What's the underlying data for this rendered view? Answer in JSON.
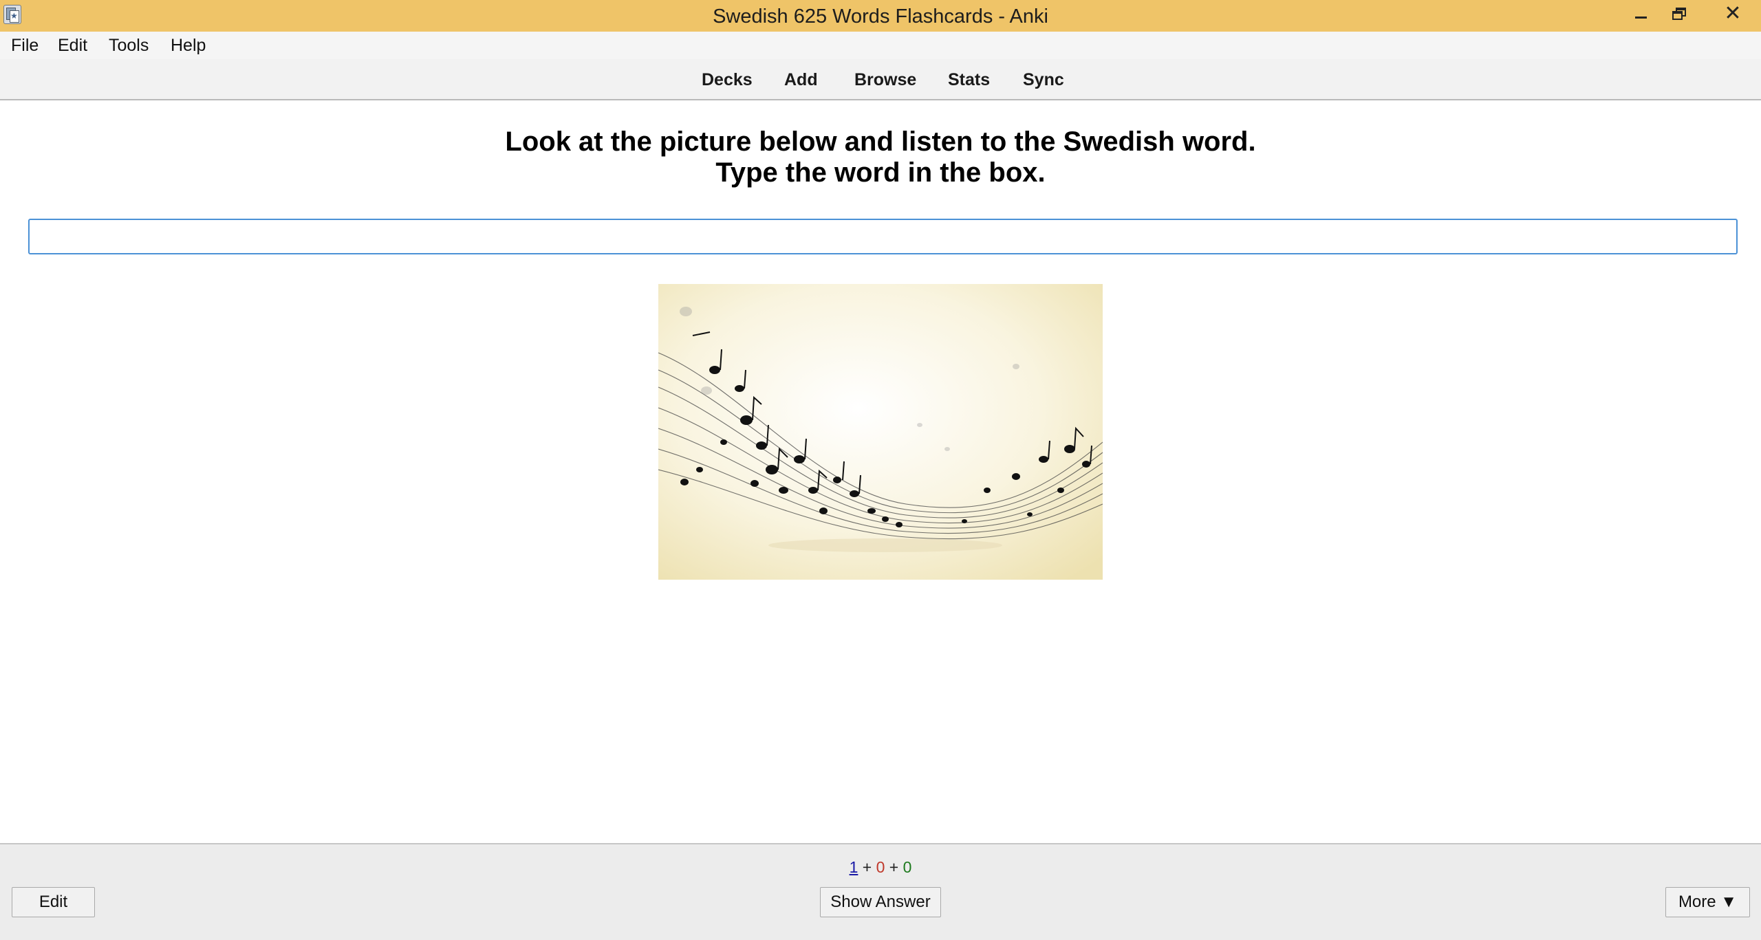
{
  "window": {
    "title": "Swedish 625 Words Flashcards - Anki",
    "close_glyph": "✕"
  },
  "menu": {
    "items": [
      "File",
      "Edit",
      "Tools",
      "Help"
    ]
  },
  "toolbar": {
    "links": [
      "Decks",
      "Add",
      "Browse",
      "Stats",
      "Sync"
    ]
  },
  "card": {
    "prompt_line1": "Look at the picture below and listen to the Swedish word.",
    "prompt_line2": "Type the word in the box.",
    "answer_value": "",
    "image_icon": "music-notes-staff-image"
  },
  "bottom": {
    "count_new": "1",
    "count_learn": "0",
    "count_review": "0",
    "separator": "+",
    "edit_label": "Edit",
    "show_answer_label": "Show Answer",
    "more_label": "More ▼"
  },
  "colors": {
    "titlebar": "#efc468",
    "input_border": "#4b91d6",
    "count_new": "#1a1aa6",
    "count_learn": "#c0392b",
    "count_review": "#1e7a1e"
  }
}
